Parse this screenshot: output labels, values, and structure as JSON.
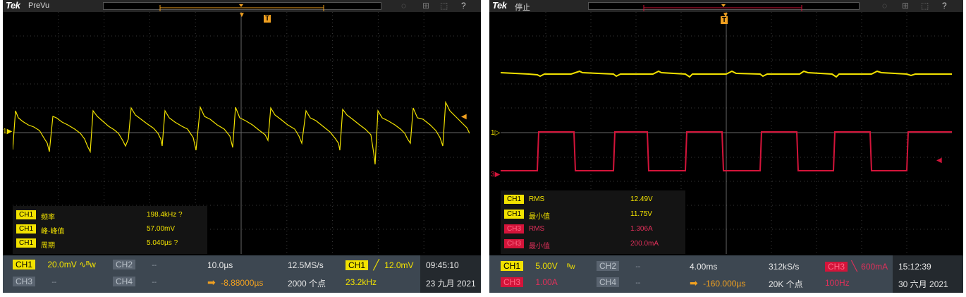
{
  "left": {
    "brand": "Tek",
    "status": "PreVu",
    "trigger_marker": "T",
    "ch1_marker": "1",
    "measurements": [
      {
        "channel": "CH1",
        "name": "频率",
        "value": "198.4kHz ?"
      },
      {
        "channel": "CH1",
        "name": "峰-峰值",
        "value": "57.00mV"
      },
      {
        "channel": "CH1",
        "name": "周期",
        "value": "5.040µs ?"
      }
    ],
    "bottom": {
      "ch1_label": "CH1",
      "ch1_scale": "20.0mV",
      "ch2_label": "CH2",
      "ch2_value": "--",
      "ch3_label": "CH3",
      "ch3_value": "--",
      "ch4_label": "CH4",
      "ch4_value": "--",
      "timebase": "10.0µs",
      "sample_rate": "12.5MS/s",
      "trig_ch": "CH1",
      "trig_level": "12.0mV",
      "position": "-8.88000µs",
      "record_length": "2000 个点",
      "trig_freq": "23.2kHz",
      "time": "09:45:10",
      "date": "23 九月 2021"
    }
  },
  "right": {
    "brand": "Tek",
    "status": "停止",
    "trigger_marker": "T",
    "ch1_marker": "1",
    "ch3_marker": "3",
    "measurements": [
      {
        "channel": "CH1",
        "name": "RMS",
        "value": "12.49V"
      },
      {
        "channel": "CH1",
        "name": "最小值",
        "value": "11.75V"
      },
      {
        "channel": "CH3",
        "name": "RMS",
        "value": "1.306A"
      },
      {
        "channel": "CH3",
        "name": "最小值",
        "value": "200.0mA"
      }
    ],
    "bottom": {
      "ch1_label": "CH1",
      "ch1_scale": "5.00V",
      "ch2_label": "CH2",
      "ch2_value": "--",
      "ch3_label": "CH3",
      "ch3_scale": "1.00A",
      "ch4_label": "CH4",
      "ch4_value": "--",
      "timebase": "4.00ms",
      "sample_rate": "312kS/s",
      "trig_ch": "CH3",
      "trig_level": "600mA",
      "position": "-160.000µs",
      "record_length": "20K 个点",
      "trig_freq": "100Hz",
      "time": "15:12:39",
      "date": "30 六月 2021"
    }
  },
  "colors": {
    "ch1": "#f2e200",
    "ch3": "#d4143a",
    "panel": "#3d4751",
    "accent": "#f0a020"
  }
}
